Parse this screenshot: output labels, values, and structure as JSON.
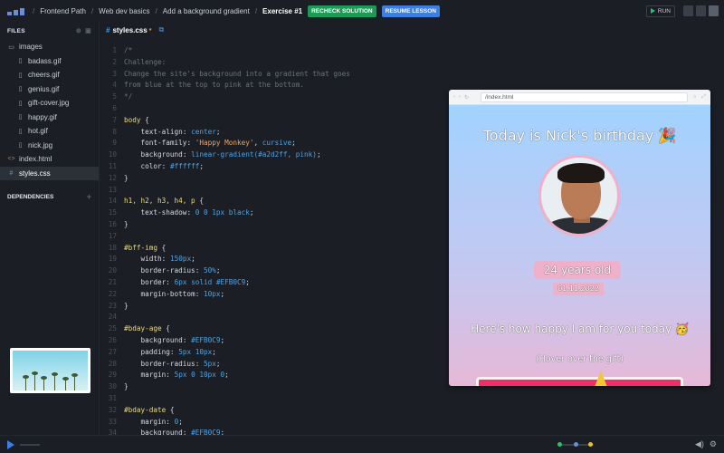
{
  "topbar": {
    "breadcrumbs": [
      "Frontend Path",
      "Web dev basics",
      "Add a background gradient",
      "Exercise #1"
    ],
    "recheck_label": "RECHECK SOLUTION",
    "resume_label": "RESUME LESSON",
    "run_label": "RUN"
  },
  "sidebar": {
    "files_label": "FILES",
    "folder": "images",
    "images": [
      "badass.gif",
      "cheers.gif",
      "genius.gif",
      "gift-cover.jpg",
      "happy.gif",
      "hot.gif",
      "nick.jpg"
    ],
    "index_file": "index.html",
    "styles_file": "styles.css",
    "dependencies_label": "DEPENDENCIES"
  },
  "editor": {
    "tab_label": "styles.css",
    "line_numbers": [
      "1",
      "2",
      "3",
      "4",
      "5",
      "6",
      "7",
      "8",
      "9",
      "10",
      "11",
      "12",
      "13",
      "14",
      "15",
      "16",
      "17",
      "18",
      "19",
      "20",
      "21",
      "22",
      "23",
      "24",
      "25",
      "26",
      "27",
      "28",
      "29",
      "30",
      "31",
      "32",
      "33",
      "34"
    ]
  },
  "code": {
    "l1": "/*",
    "l2": "Challenge:",
    "l3": "Change the site's background into a gradient that goes",
    "l4": "from blue at the top to pink at the bottom.",
    "l5": "*/",
    "l7_sel": "body",
    "l8_p": "text-align",
    "l8_v": "center",
    "l9_p": "font-family",
    "l9_s": "'Happy Monkey'",
    "l9_v": "cursive",
    "l10_p": "background",
    "l10_v": "linear-gradient(#a2d2ff, pink)",
    "l11_p": "color",
    "l11_v": "#ffffff",
    "l14_sel": "h1, h2, h3, h4, p",
    "l15_p": "text-shadow",
    "l15_v": "0 0 1px black",
    "l18_sel": "#bff-img",
    "l19_p": "width",
    "l19_v": "150px",
    "l20_p": "border-radius",
    "l20_v": "50%",
    "l21_p": "border",
    "l21_v": "6px solid #EFB0C9",
    "l22_p": "margin-bottom",
    "l22_v": "10px",
    "l25_sel": "#bday-age",
    "l26_p": "background",
    "l26_v": "#EFB0C9",
    "l27_p": "padding",
    "l27_v": "5px 10px",
    "l28_p": "border-radius",
    "l28_v": "5px",
    "l29_p": "margin",
    "l29_v": "5px 0 10px 0",
    "l32_sel": "#bday-date",
    "l33_p": "margin",
    "l33_v": "0",
    "l34_p": "background",
    "l34_v": "#EFB0C9"
  },
  "preview": {
    "url": "/index.html",
    "title": "Today is Nick's birthday 🎉",
    "age": "24 years old",
    "date": "01.11.2022",
    "happy": "Here's how happy I am for you today 🥳",
    "hover": "(Hover over the gift)"
  },
  "colors": {
    "accent": "#3c7fe0",
    "recheck": "#1d9a56",
    "pink": "#EFB0C9",
    "sky": "#a2d2ff"
  },
  "icons": {
    "logo": "scrimba-logo-icon",
    "folder": "folder-icon",
    "file": "file-icon",
    "html": "html-file-icon",
    "css": "css-file-icon",
    "play": "play-icon"
  }
}
